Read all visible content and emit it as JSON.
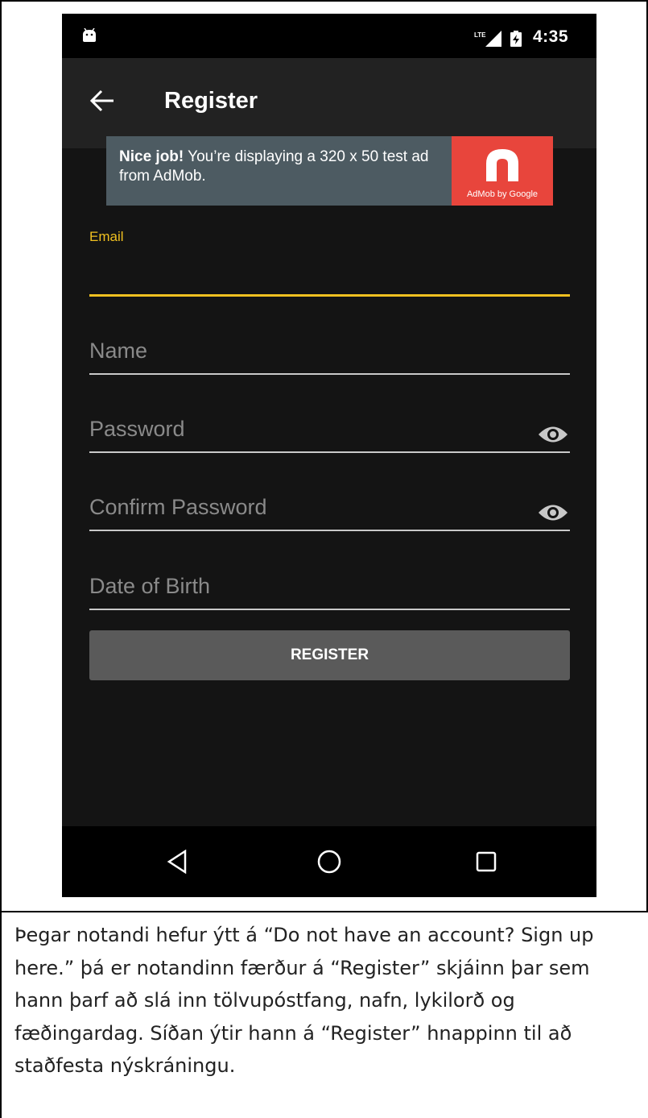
{
  "status_bar": {
    "time": "4:35",
    "network": "LTE",
    "icons": [
      "android-debug-icon",
      "signal-icon",
      "battery-icon"
    ]
  },
  "app_bar": {
    "title": "Register",
    "back_icon": "arrow-back-icon"
  },
  "ad": {
    "headline": "Nice job!",
    "body": " You’re displaying a 320 x 50 test ad from AdMob.",
    "logo_caption": "AdMob by Google",
    "logo_color": "#e8453c"
  },
  "form": {
    "email_label": "Email",
    "email_value": "",
    "name_placeholder": "Name",
    "password_placeholder": "Password",
    "confirm_password_placeholder": "Confirm Password",
    "dob_placeholder": "Date of Birth",
    "submit_label": "REGISTER",
    "accent_color": "#f0c020"
  },
  "nav_bar": {
    "icons": [
      "nav-back-icon",
      "nav-home-icon",
      "nav-recents-icon"
    ]
  },
  "caption": "Þegar notandi hefur ýtt á “Do not have an account? Sign up here.” þá er notandinn færður á “Register” skjáinn þar sem hann þarf að slá inn tölvupóstfang, nafn, lykilorð og fæðingardag. Síðan ýtir hann á “Register” hnappinn til að staðfesta nýskráningu."
}
